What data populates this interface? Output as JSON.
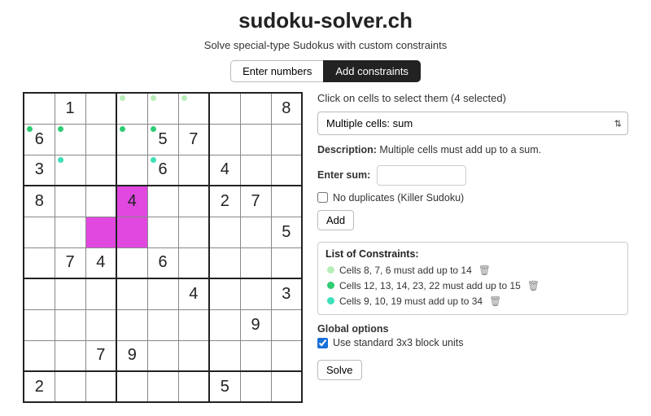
{
  "header": {
    "title": "sudoku-solver.ch",
    "subtitle": "Solve special-type Sudokus with custom constraints"
  },
  "tabs": {
    "enter": "Enter numbers",
    "constraints": "Add constraints"
  },
  "grid": [
    [
      "",
      "1",
      "",
      "",
      "",
      "",
      "",
      "",
      "8"
    ],
    [
      "6",
      "",
      "",
      "",
      "5",
      "7",
      "",
      "",
      ""
    ],
    [
      "3",
      "",
      "",
      "",
      "6",
      "",
      "4",
      "",
      ""
    ],
    [
      "8",
      "",
      "",
      "4",
      "",
      "",
      "2",
      "7",
      ""
    ],
    [
      "",
      "",
      "",
      "",
      "",
      "",
      "",
      "",
      "5"
    ],
    [
      "",
      "7",
      "4",
      "",
      "6",
      "",
      "",
      "",
      ""
    ],
    [
      "",
      "",
      "",
      "",
      "",
      "4",
      "",
      "",
      "3"
    ],
    [
      "",
      "",
      "",
      "",
      "",
      "",
      "",
      "9",
      ""
    ],
    [
      "",
      "",
      "7",
      "9",
      "",
      "",
      "",
      "",
      ""
    ],
    [
      "2",
      "",
      "",
      "",
      "",
      "",
      "5",
      "",
      ""
    ]
  ],
  "gridRows": 10,
  "selectedCells": [
    "3,3",
    "4,2",
    "4,3"
  ],
  "dots": {
    "0,3": "pale",
    "0,4": "pale",
    "0,5": "pale",
    "1,0": "green",
    "1,1": "green",
    "1,3": "green",
    "1,4": "green",
    "2,1": "teal",
    "2,4": "teal"
  },
  "side": {
    "hint": "Click on cells to select them (4 selected)",
    "selectValue": "Multiple cells: sum",
    "descLabel": "Description:",
    "descText": "Multiple cells must add up to a sum.",
    "enterSumLabel": "Enter sum:",
    "noDupLabel": "No duplicates (Killer Sudoku)",
    "addLabel": "Add",
    "constraintsTitle": "List of Constraints:",
    "constraints": [
      {
        "color": "pale",
        "text": "Cells 8, 7, 6 must add up to 14"
      },
      {
        "color": "green",
        "text": "Cells 12, 13, 14, 23, 22 must add up to 15"
      },
      {
        "color": "teal",
        "text": "Cells 9, 10, 19 must add up to 34"
      }
    ],
    "globalTitle": "Global options",
    "globalOpt": "Use standard 3x3 block units",
    "solveLabel": "Solve"
  }
}
